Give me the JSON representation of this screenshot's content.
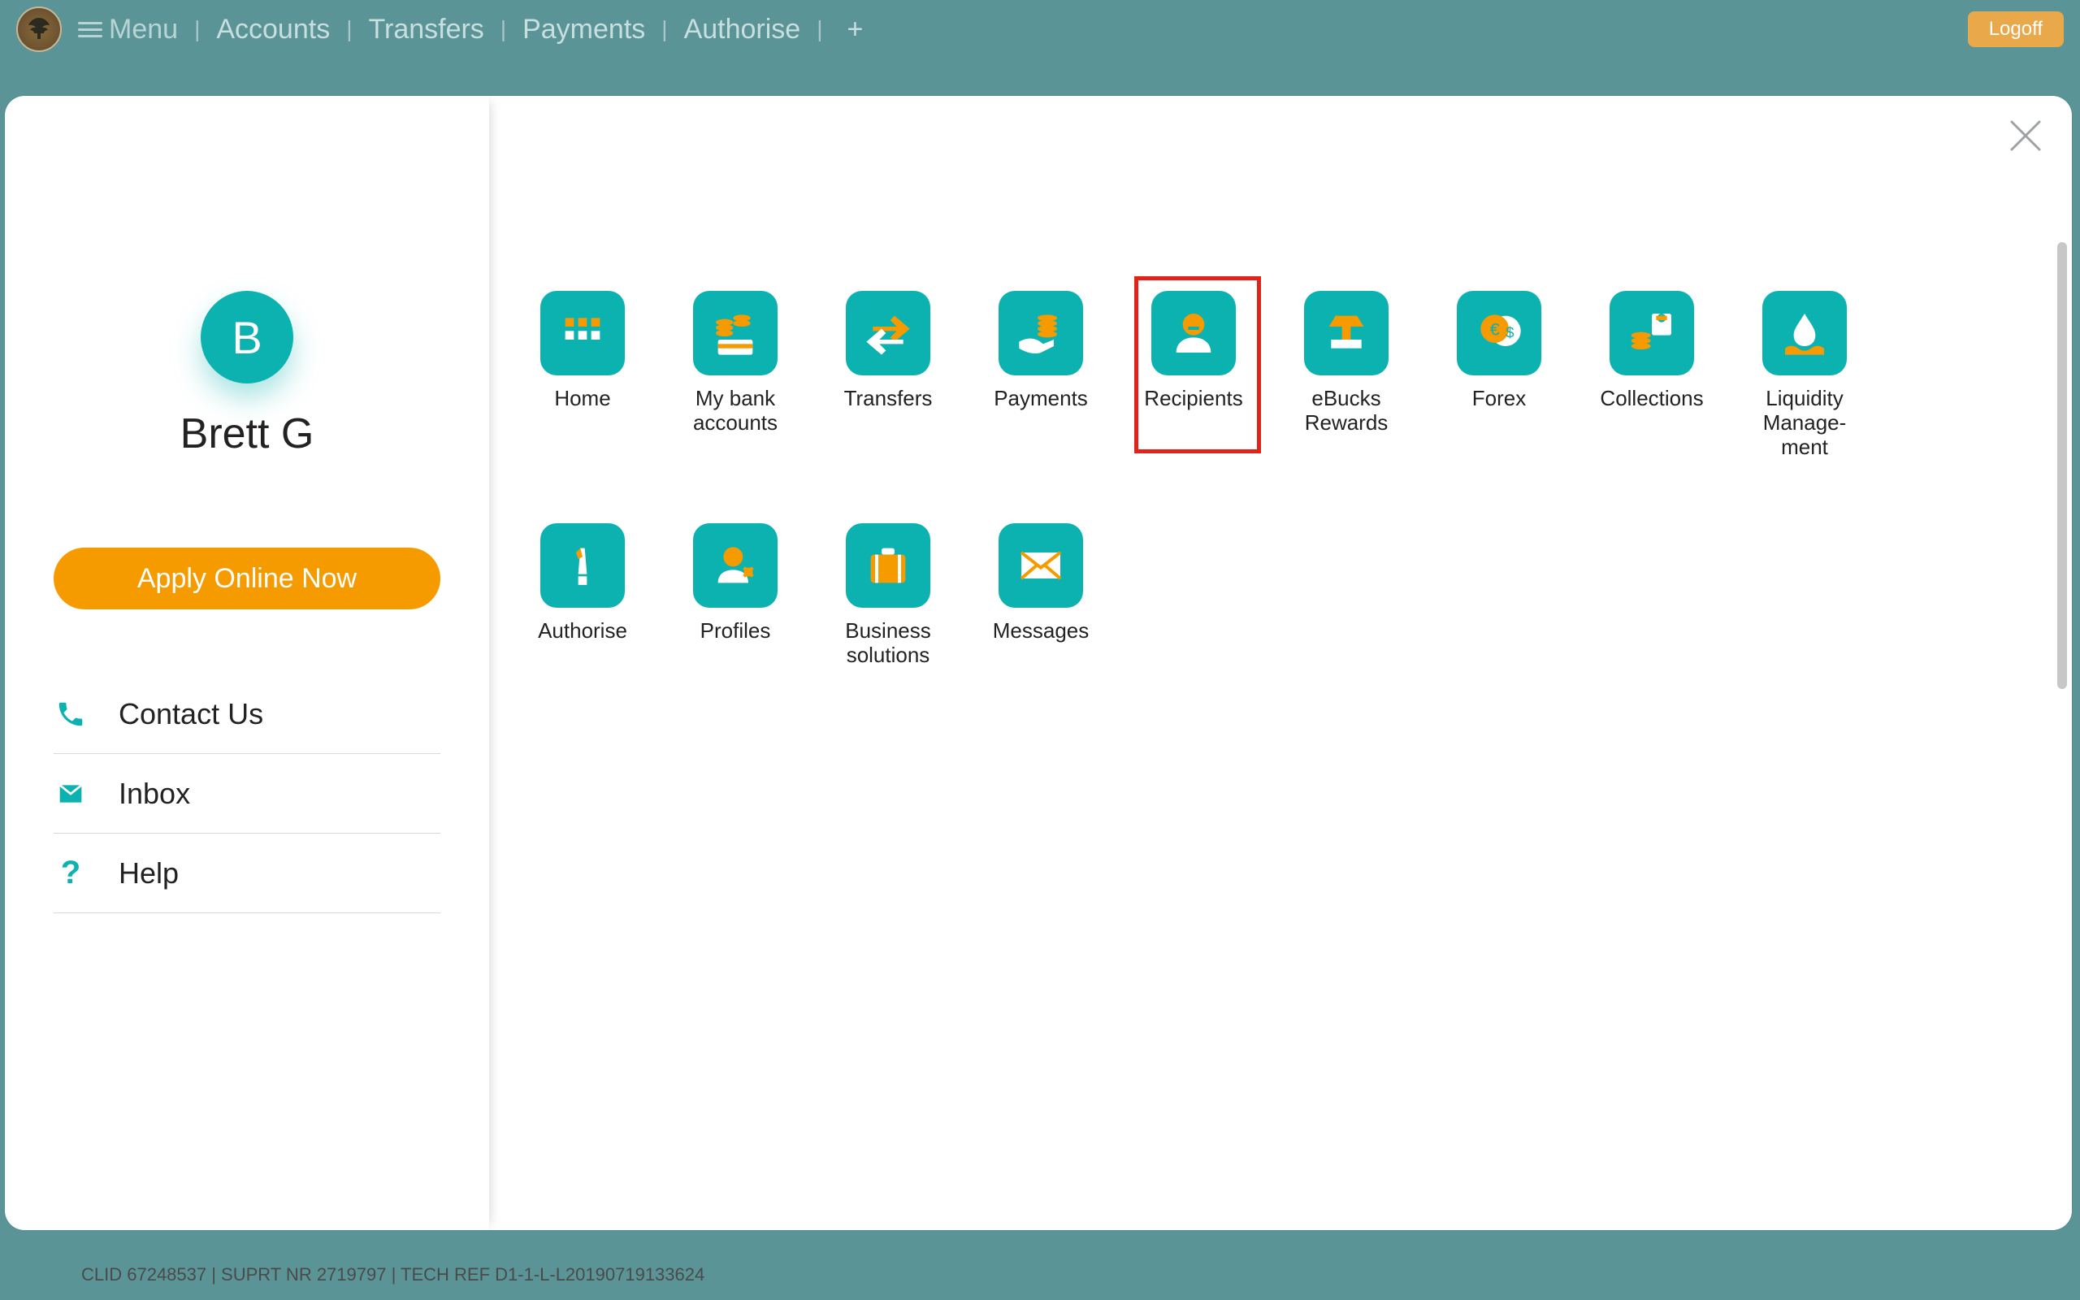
{
  "topbar": {
    "menu_label": "Menu",
    "nav": [
      "Accounts",
      "Transfers",
      "Payments",
      "Authorise"
    ],
    "logoff_label": "Logoff"
  },
  "sidebar": {
    "avatar_initial": "B",
    "profile_name": "Brett G",
    "apply_label": "Apply Online Now",
    "items": [
      {
        "icon": "phone",
        "label": "Contact Us"
      },
      {
        "icon": "mail",
        "label": "Inbox"
      },
      {
        "icon": "help",
        "label": "Help"
      }
    ]
  },
  "menu": {
    "highlight_index": 4,
    "tiles": [
      {
        "key": "home",
        "label": "Home"
      },
      {
        "key": "accounts",
        "label": "My bank\naccounts"
      },
      {
        "key": "transfers",
        "label": "Transfers"
      },
      {
        "key": "payments",
        "label": "Payments"
      },
      {
        "key": "recipients",
        "label": "Recipients"
      },
      {
        "key": "ebucks",
        "label": "eBucks\nRewards"
      },
      {
        "key": "forex",
        "label": "Forex"
      },
      {
        "key": "collections",
        "label": "Collections"
      },
      {
        "key": "liquidity",
        "label": "Liquidity\nManage-\nment"
      },
      {
        "key": "authorise",
        "label": "Authorise"
      },
      {
        "key": "profiles",
        "label": "Profiles"
      },
      {
        "key": "business",
        "label": "Business\nsolutions"
      },
      {
        "key": "messages",
        "label": "Messages"
      }
    ]
  },
  "footer": {
    "text": "CLID 67248537 | SUPRT NR 2719797 | TECH REF D1-1-L-L20190719133624"
  }
}
